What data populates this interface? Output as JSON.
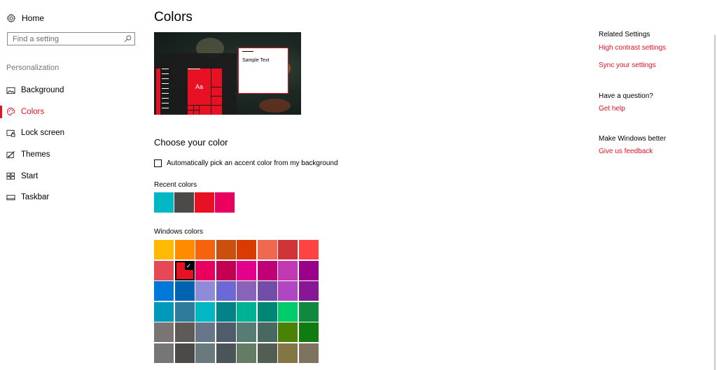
{
  "sidebar": {
    "home_label": "Home",
    "search_placeholder": "Find a setting",
    "section_label": "Personalization",
    "items": [
      {
        "label": "Background",
        "icon": "picture-icon"
      },
      {
        "label": "Colors",
        "icon": "palette-icon",
        "active": true
      },
      {
        "label": "Lock screen",
        "icon": "lock-screen-icon"
      },
      {
        "label": "Themes",
        "icon": "themes-icon"
      },
      {
        "label": "Start",
        "icon": "start-icon"
      },
      {
        "label": "Taskbar",
        "icon": "taskbar-icon"
      }
    ]
  },
  "main": {
    "title": "Colors",
    "preview": {
      "sample_text": "Sample Text",
      "tile_text": "Aa"
    },
    "choose_heading": "Choose your color",
    "auto_pick_label": "Automatically pick an accent color from my background",
    "auto_pick_checked": false,
    "recent_label": "Recent colors",
    "recent_colors": [
      "#00B7C3",
      "#4C4A48",
      "#E81123",
      "#EA005E"
    ],
    "windows_label": "Windows colors",
    "windows_colors": [
      "#FFB900",
      "#FF8C00",
      "#F7630C",
      "#CA5010",
      "#DA3B01",
      "#EF6950",
      "#D13438",
      "#FF4343",
      "#E74856",
      "#E81123",
      "#EA005E",
      "#C30052",
      "#E3008C",
      "#BF0077",
      "#C239B3",
      "#9A0089",
      "#0078D7",
      "#0063B1",
      "#8E8CD8",
      "#6B69D6",
      "#8764B8",
      "#744DA9",
      "#B146C2",
      "#881798",
      "#0099BC",
      "#2D7D9A",
      "#00B7C3",
      "#038387",
      "#00B294",
      "#018574",
      "#00CC6A",
      "#10893E",
      "#7A7574",
      "#5D5A58",
      "#68768A",
      "#515C6B",
      "#567C73",
      "#486860",
      "#498205",
      "#107C10",
      "#767676",
      "#4C4A48",
      "#69797E",
      "#4A5459",
      "#647C64",
      "#525E54",
      "#847545",
      "#7E735F"
    ],
    "selected_color": "#E81123",
    "accent_color": "#E81123"
  },
  "related": {
    "heading": "Related Settings",
    "links": [
      "High contrast settings",
      "Sync your settings"
    ]
  },
  "question": {
    "heading": "Have a question?",
    "link": "Get help"
  },
  "better": {
    "heading": "Make Windows better",
    "link": "Give us feedback"
  }
}
